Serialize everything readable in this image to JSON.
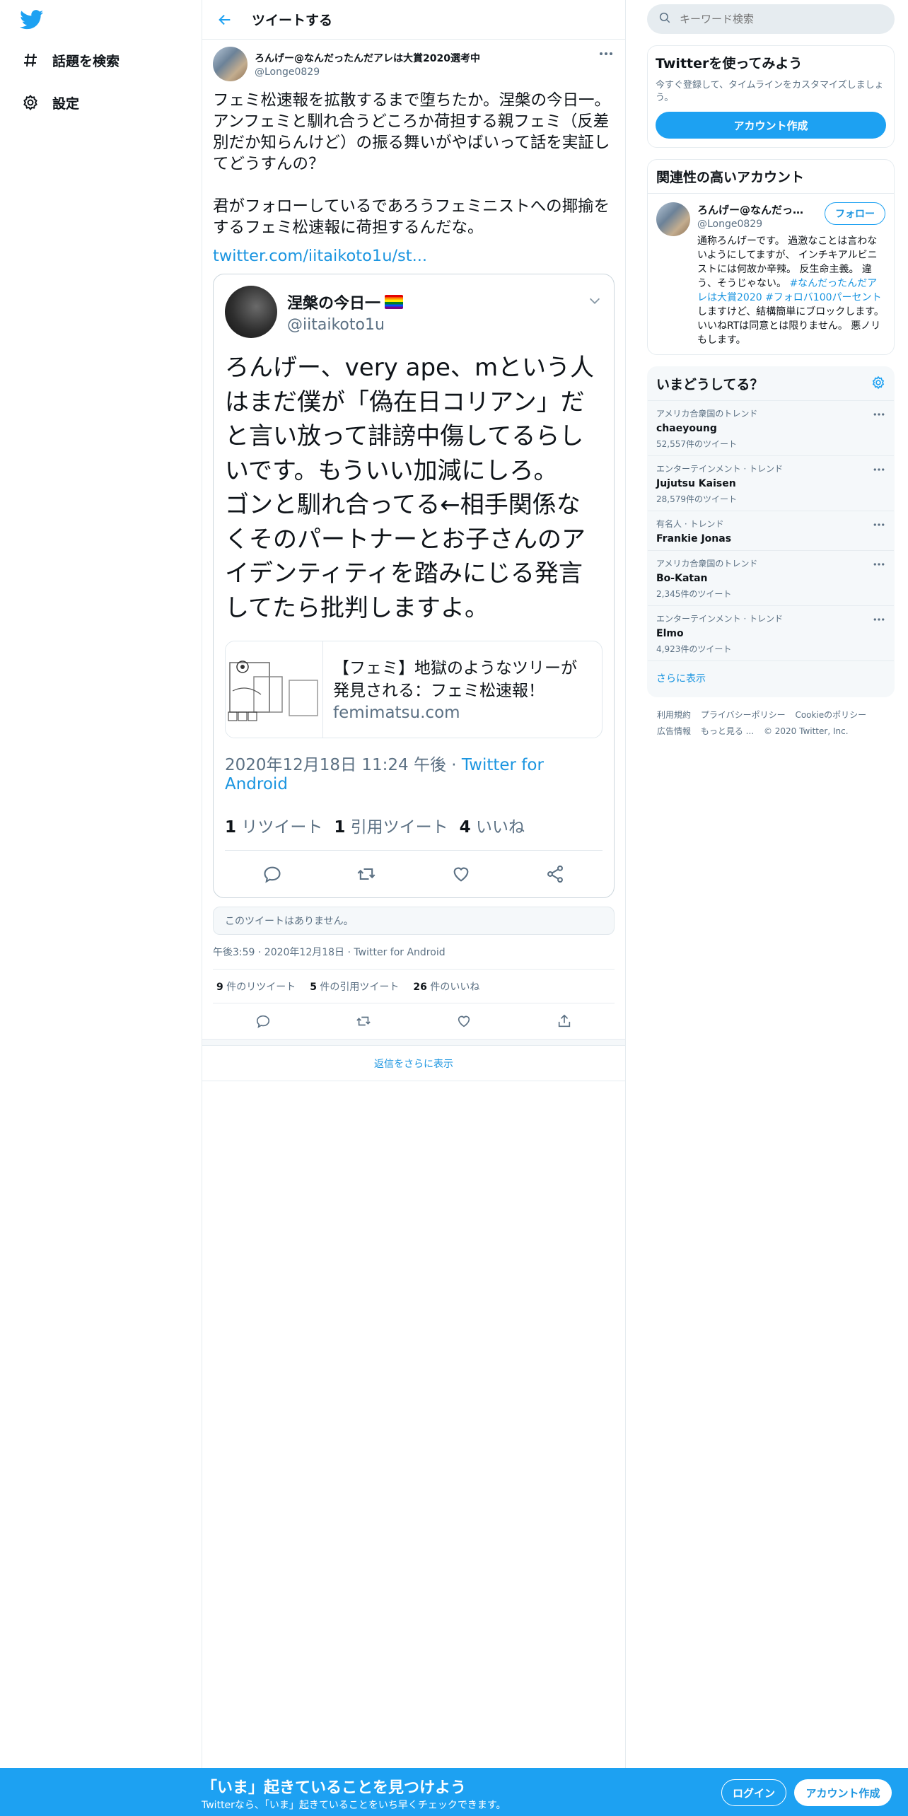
{
  "nav": {
    "items": [
      {
        "label": "話題を検索",
        "icon": "hashtag-icon"
      },
      {
        "label": "設定",
        "icon": "gear-icon"
      }
    ]
  },
  "header": {
    "title": "ツイートする"
  },
  "tweet": {
    "author_name": "ろんげー@なんだったんだアレは大賞2020選考中",
    "author_handle": "@Longe0829",
    "text": "フェミ松速報を拡散するまで堕ちたか。涅槃の今日一。\nアンフェミと馴れ合うどころか荷担する親フェミ（反差別だか知らんけど）の振る舞いがやばいって話を実証してどうすんの？\n\n君がフォローしているであろうフェミニストへの揶揄をするフェミ松速報に荷担するんだな。",
    "link": "twitter.com/iitaikoto1u/st...",
    "embed": {
      "name": "涅槃の今日一",
      "handle": "@iitaikoto1u",
      "text": "ろんげー、very ape、mという人はまだ僕が「偽在日コリアン」だと言い放って誹謗中傷してるらしいです。もういい加減にしろ。\nゴンと馴れ合ってる←相手関係なくそのパートナーとお子さんのアイデンティティを踏みにじる発言してたら批判しますよ。",
      "card_title": "【フェミ】地獄のようなツリーが発見される：フェミ松速報！",
      "card_domain": "femimatsu.com",
      "meta_time": "2020年12月18日 11:24 午後 · ",
      "meta_source": "Twitter for Android",
      "retweets_num": "1",
      "retweets_label": "リツイート",
      "quotes_num": "1",
      "quotes_label": "引用ツイート",
      "likes_num": "4",
      "likes_label": "いいね"
    },
    "unavailable": "このツイートはありません。",
    "meta": "午後3:59 · 2020年12月18日 · Twitter for Android",
    "stats": {
      "retweets_num": "9",
      "retweets_label": "件のリツイート",
      "quotes_num": "5",
      "quotes_label": "件の引用ツイート",
      "likes_num": "26",
      "likes_label": "件のいいね"
    },
    "more_replies": "返信をさらに表示"
  },
  "sidebar": {
    "search_placeholder": "キーワード検索",
    "signup_panel": {
      "title": "Twitterを使ってみよう",
      "subtitle": "今すぐ登録して、タイムラインをカスタマイズしましょう。",
      "button": "アカウント作成"
    },
    "related": {
      "title": "関連性の高いアカウント",
      "name": "ろんげー@なんだったんだアレは大賞2020選考中",
      "handle": "@Longe0829",
      "follow": "フォロー",
      "bio_1": "通称ろんげーです。 過激なことは言わないようにしてますが、 インチキアルビニストには何故か辛辣。 反生命主義。 違う、そうじゃない。 ",
      "bio_tags": "#なんだったんだアレは大賞2020 #フォロバ100パーセント",
      "bio_2": " しますけど、結構簡単にブロックします。 いいねRTは同意とは限りません。 悪ノリもします。"
    },
    "trends": {
      "title": "いまどうしてる？",
      "items": [
        {
          "category": "アメリカ合衆国のトレンド",
          "name": "chaeyoung",
          "count": "52,557件のツイート"
        },
        {
          "category": "エンターテインメント · トレンド",
          "name": "Jujutsu Kaisen",
          "count": "28,579件のツイート"
        },
        {
          "category": "有名人 · トレンド",
          "name": "Frankie Jonas",
          "count": ""
        },
        {
          "category": "アメリカ合衆国のトレンド",
          "name": "Bo-Katan",
          "count": "2,345件のツイート"
        },
        {
          "category": "エンターテインメント · トレンド",
          "name": "Elmo",
          "count": "4,923件のツイート"
        }
      ],
      "show_more": "さらに表示"
    },
    "footer": {
      "terms": "利用規約",
      "privacy": "プライバシーポリシー",
      "cookie": "Cookieのポリシー",
      "ads": "広告情報",
      "more": "もっと見る ...",
      "copyright": "© 2020 Twitter, Inc."
    }
  },
  "bottombar": {
    "title": "「いま」起きていることを見つけよう",
    "subtitle": "Twitterなら、「いま」起きていることをいち早くチェックできます。",
    "login": "ログイン",
    "signup": "アカウント作成"
  },
  "colors": {
    "accent": "#1da1f2",
    "link": "#1b95e0",
    "muted": "#5b7083"
  }
}
